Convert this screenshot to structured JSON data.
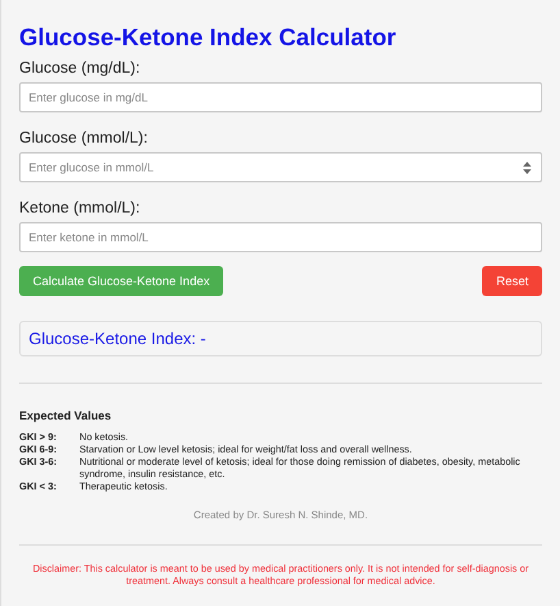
{
  "title": "Glucose-Ketone Index Calculator",
  "fields": [
    {
      "label": "Glucose (mg/dL):",
      "placeholder": "Enter glucose in mg/dL",
      "kind": "text"
    },
    {
      "label": "Glucose (mmol/L):",
      "placeholder": "Enter glucose in mmol/L",
      "kind": "number"
    },
    {
      "label": "Ketone (mmol/L):",
      "placeholder": "Enter ketone in mmol/L",
      "kind": "text"
    }
  ],
  "buttons": {
    "calculate": "Calculate Glucose-Ketone Index",
    "reset": "Reset"
  },
  "result": "Glucose-Ketone Index: -",
  "expected_values": {
    "heading": "Expected Values",
    "rows": [
      {
        "range": "GKI > 9:",
        "description": "No ketosis."
      },
      {
        "range": "GKI 6-9:",
        "description": "Starvation or Low level ketosis; ideal for weight/fat loss and overall wellness."
      },
      {
        "range": "GKI 3-6:",
        "description": "Nutritional or moderate level of ketosis; ideal for those doing remission of diabetes, obesity, metabolic syndrome, insulin resistance, etc."
      },
      {
        "range": "GKI < 3:",
        "description": "Therapeutic ketosis."
      }
    ]
  },
  "credit": "Created by Dr. Suresh N. Shinde, MD.",
  "disclaimer": "Disclaimer: This calculator is meant to be used by medical practitioners only. It is not intended for self-diagnosis or treatment. Always consult a healthcare professional for medical advice."
}
